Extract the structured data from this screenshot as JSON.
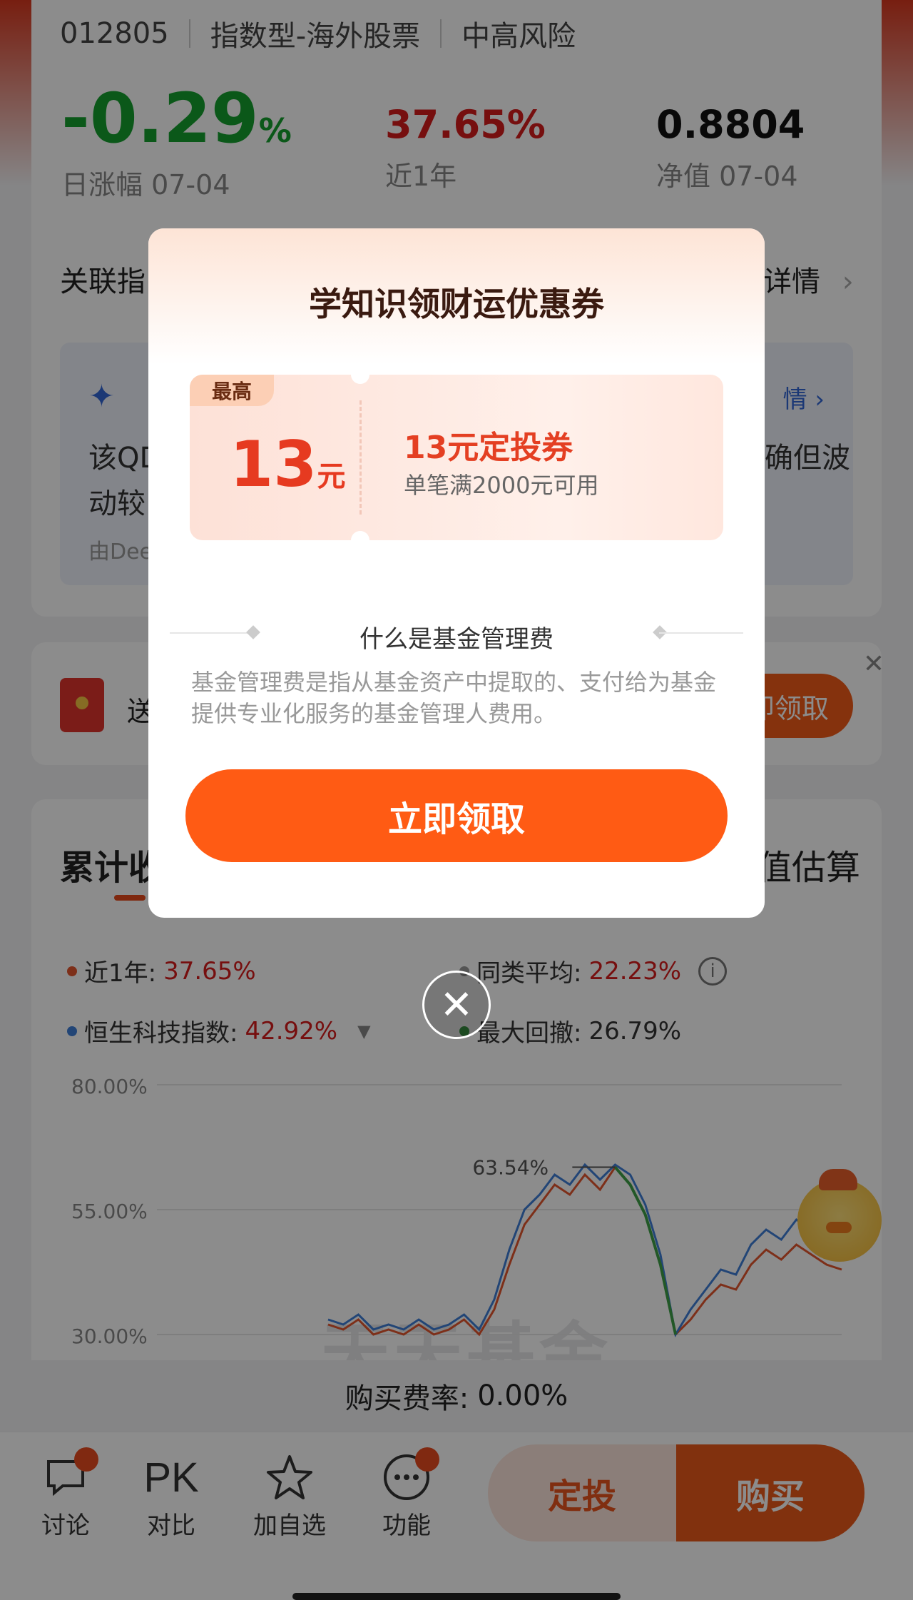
{
  "header": {
    "fund_code": "012805",
    "fund_type": "指数型-海外股票",
    "risk": "中高风险"
  },
  "stats": {
    "daily_change": {
      "value": "-0.29",
      "unit": "%",
      "label": "日涨幅 07-04"
    },
    "one_year": {
      "value": "37.65%",
      "label": "近1年"
    },
    "nav": {
      "value": "0.8804",
      "label": "净值 07-04"
    }
  },
  "related": {
    "label_visible": "关联指",
    "detail_visible": "详情"
  },
  "ai_box": {
    "line1_left": "该QD",
    "line2_left": "动较",
    "line1_right": "确但波",
    "footer_left": "由Dee",
    "detail_link": "情"
  },
  "gift": {
    "text_visible": "送",
    "button_visible": "即领取"
  },
  "chart_tabs": {
    "left_visible": "累计收",
    "right_visible": "值估算"
  },
  "legend": {
    "one_year": {
      "label": "近1年:",
      "value": "37.65%"
    },
    "peer_avg": {
      "label": "同类平均:",
      "value": "22.23%"
    },
    "index": {
      "label": "恒生科技指数:",
      "value": "42.92%"
    },
    "max_drawdown": {
      "label": "最大回撤:",
      "value": "26.79%"
    }
  },
  "chart_data": {
    "type": "line",
    "y_ticks": [
      "80.00%",
      "55.00%",
      "30.00%"
    ],
    "ylim_visible": [
      30,
      80
    ],
    "peak_label": "63.54%",
    "series": [
      {
        "values": [
          32,
          31,
          33,
          30,
          31,
          30,
          32,
          30,
          31,
          33,
          30,
          35,
          44,
          52,
          56,
          60,
          58,
          62,
          59,
          63.5,
          60,
          54,
          44,
          30,
          33,
          37,
          40,
          39,
          44,
          47,
          45,
          48,
          46,
          44,
          43
        ]
      },
      {
        "values": [
          33,
          32,
          34,
          31,
          32,
          31,
          33,
          31,
          32,
          34,
          31,
          37,
          47,
          55,
          58,
          62,
          60,
          64,
          61,
          64,
          62,
          56,
          46,
          30,
          35,
          39,
          43,
          42,
          48,
          51,
          49,
          53,
          51,
          50,
          48
        ]
      }
    ],
    "colors": {
      "fund": "#e4572e",
      "index": "#3f7fd8",
      "drawdown": "#3fa047"
    }
  },
  "watermark": "天天基金",
  "fee": {
    "label": "购买费率:",
    "value": "0.00%"
  },
  "toolbar": {
    "discuss": "讨论",
    "pk_glyph": "PK",
    "compare": "对比",
    "watchlist": "加自选",
    "functions": "功能",
    "dingtou": "定投",
    "buy": "购买"
  },
  "modal": {
    "title": "学知识领财运优惠券",
    "coupon": {
      "tag": "最高",
      "amount": "13",
      "unit": "元",
      "name": "13元定投券",
      "condition": "单笔满2000元可用"
    },
    "section_title": "什么是基金管理费",
    "section_body": "基金管理费是指从基金资产中提取的、支付给为基金提供专业化服务的基金管理人费用。",
    "claim_button": "立即领取",
    "close_glyph": "✕"
  },
  "gift_close_glyph": "✕"
}
